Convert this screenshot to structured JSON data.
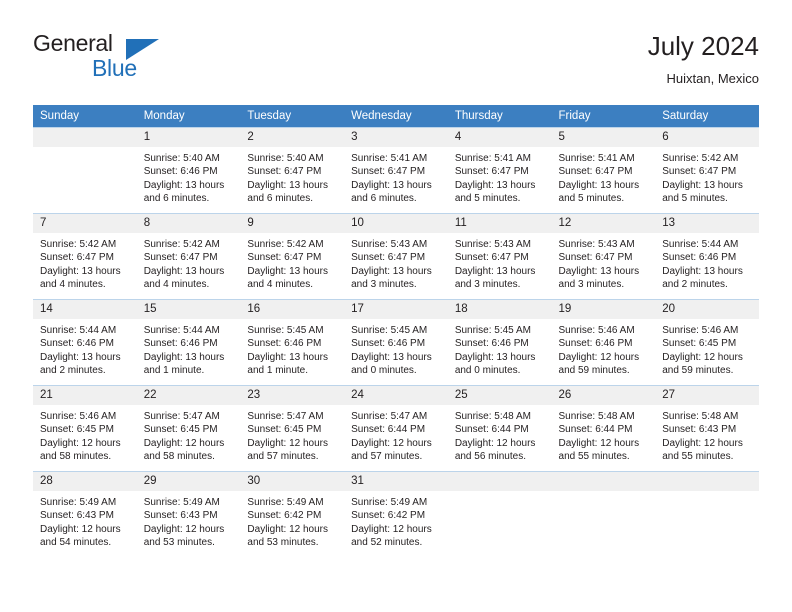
{
  "brand": {
    "name_part1": "General",
    "name_part2": "Blue",
    "accent_color": "#2170b8",
    "triangle_icon": "triangle-icon"
  },
  "header": {
    "title": "July 2024",
    "subtitle": "Huixtan, Mexico"
  },
  "calendar": {
    "header_bg": "#3c7fc1",
    "daynum_bg": "#f0f0f0",
    "grid_line_color": "#bcd4ea",
    "weekdays": [
      "Sunday",
      "Monday",
      "Tuesday",
      "Wednesday",
      "Thursday",
      "Friday",
      "Saturday"
    ],
    "weeks": [
      [
        {
          "day": "",
          "sunrise": "",
          "sunset": "",
          "daylight1": "",
          "daylight2": "",
          "empty": true
        },
        {
          "day": "1",
          "sunrise": "Sunrise: 5:40 AM",
          "sunset": "Sunset: 6:46 PM",
          "daylight1": "Daylight: 13 hours",
          "daylight2": "and 6 minutes.",
          "empty": false
        },
        {
          "day": "2",
          "sunrise": "Sunrise: 5:40 AM",
          "sunset": "Sunset: 6:47 PM",
          "daylight1": "Daylight: 13 hours",
          "daylight2": "and 6 minutes.",
          "empty": false
        },
        {
          "day": "3",
          "sunrise": "Sunrise: 5:41 AM",
          "sunset": "Sunset: 6:47 PM",
          "daylight1": "Daylight: 13 hours",
          "daylight2": "and 6 minutes.",
          "empty": false
        },
        {
          "day": "4",
          "sunrise": "Sunrise: 5:41 AM",
          "sunset": "Sunset: 6:47 PM",
          "daylight1": "Daylight: 13 hours",
          "daylight2": "and 5 minutes.",
          "empty": false
        },
        {
          "day": "5",
          "sunrise": "Sunrise: 5:41 AM",
          "sunset": "Sunset: 6:47 PM",
          "daylight1": "Daylight: 13 hours",
          "daylight2": "and 5 minutes.",
          "empty": false
        },
        {
          "day": "6",
          "sunrise": "Sunrise: 5:42 AM",
          "sunset": "Sunset: 6:47 PM",
          "daylight1": "Daylight: 13 hours",
          "daylight2": "and 5 minutes.",
          "empty": false
        }
      ],
      [
        {
          "day": "7",
          "sunrise": "Sunrise: 5:42 AM",
          "sunset": "Sunset: 6:47 PM",
          "daylight1": "Daylight: 13 hours",
          "daylight2": "and 4 minutes.",
          "empty": false
        },
        {
          "day": "8",
          "sunrise": "Sunrise: 5:42 AM",
          "sunset": "Sunset: 6:47 PM",
          "daylight1": "Daylight: 13 hours",
          "daylight2": "and 4 minutes.",
          "empty": false
        },
        {
          "day": "9",
          "sunrise": "Sunrise: 5:42 AM",
          "sunset": "Sunset: 6:47 PM",
          "daylight1": "Daylight: 13 hours",
          "daylight2": "and 4 minutes.",
          "empty": false
        },
        {
          "day": "10",
          "sunrise": "Sunrise: 5:43 AM",
          "sunset": "Sunset: 6:47 PM",
          "daylight1": "Daylight: 13 hours",
          "daylight2": "and 3 minutes.",
          "empty": false
        },
        {
          "day": "11",
          "sunrise": "Sunrise: 5:43 AM",
          "sunset": "Sunset: 6:47 PM",
          "daylight1": "Daylight: 13 hours",
          "daylight2": "and 3 minutes.",
          "empty": false
        },
        {
          "day": "12",
          "sunrise": "Sunrise: 5:43 AM",
          "sunset": "Sunset: 6:47 PM",
          "daylight1": "Daylight: 13 hours",
          "daylight2": "and 3 minutes.",
          "empty": false
        },
        {
          "day": "13",
          "sunrise": "Sunrise: 5:44 AM",
          "sunset": "Sunset: 6:46 PM",
          "daylight1": "Daylight: 13 hours",
          "daylight2": "and 2 minutes.",
          "empty": false
        }
      ],
      [
        {
          "day": "14",
          "sunrise": "Sunrise: 5:44 AM",
          "sunset": "Sunset: 6:46 PM",
          "daylight1": "Daylight: 13 hours",
          "daylight2": "and 2 minutes.",
          "empty": false
        },
        {
          "day": "15",
          "sunrise": "Sunrise: 5:44 AM",
          "sunset": "Sunset: 6:46 PM",
          "daylight1": "Daylight: 13 hours",
          "daylight2": "and 1 minute.",
          "empty": false
        },
        {
          "day": "16",
          "sunrise": "Sunrise: 5:45 AM",
          "sunset": "Sunset: 6:46 PM",
          "daylight1": "Daylight: 13 hours",
          "daylight2": "and 1 minute.",
          "empty": false
        },
        {
          "day": "17",
          "sunrise": "Sunrise: 5:45 AM",
          "sunset": "Sunset: 6:46 PM",
          "daylight1": "Daylight: 13 hours",
          "daylight2": "and 0 minutes.",
          "empty": false
        },
        {
          "day": "18",
          "sunrise": "Sunrise: 5:45 AM",
          "sunset": "Sunset: 6:46 PM",
          "daylight1": "Daylight: 13 hours",
          "daylight2": "and 0 minutes.",
          "empty": false
        },
        {
          "day": "19",
          "sunrise": "Sunrise: 5:46 AM",
          "sunset": "Sunset: 6:46 PM",
          "daylight1": "Daylight: 12 hours",
          "daylight2": "and 59 minutes.",
          "empty": false
        },
        {
          "day": "20",
          "sunrise": "Sunrise: 5:46 AM",
          "sunset": "Sunset: 6:45 PM",
          "daylight1": "Daylight: 12 hours",
          "daylight2": "and 59 minutes.",
          "empty": false
        }
      ],
      [
        {
          "day": "21",
          "sunrise": "Sunrise: 5:46 AM",
          "sunset": "Sunset: 6:45 PM",
          "daylight1": "Daylight: 12 hours",
          "daylight2": "and 58 minutes.",
          "empty": false
        },
        {
          "day": "22",
          "sunrise": "Sunrise: 5:47 AM",
          "sunset": "Sunset: 6:45 PM",
          "daylight1": "Daylight: 12 hours",
          "daylight2": "and 58 minutes.",
          "empty": false
        },
        {
          "day": "23",
          "sunrise": "Sunrise: 5:47 AM",
          "sunset": "Sunset: 6:45 PM",
          "daylight1": "Daylight: 12 hours",
          "daylight2": "and 57 minutes.",
          "empty": false
        },
        {
          "day": "24",
          "sunrise": "Sunrise: 5:47 AM",
          "sunset": "Sunset: 6:44 PM",
          "daylight1": "Daylight: 12 hours",
          "daylight2": "and 57 minutes.",
          "empty": false
        },
        {
          "day": "25",
          "sunrise": "Sunrise: 5:48 AM",
          "sunset": "Sunset: 6:44 PM",
          "daylight1": "Daylight: 12 hours",
          "daylight2": "and 56 minutes.",
          "empty": false
        },
        {
          "day": "26",
          "sunrise": "Sunrise: 5:48 AM",
          "sunset": "Sunset: 6:44 PM",
          "daylight1": "Daylight: 12 hours",
          "daylight2": "and 55 minutes.",
          "empty": false
        },
        {
          "day": "27",
          "sunrise": "Sunrise: 5:48 AM",
          "sunset": "Sunset: 6:43 PM",
          "daylight1": "Daylight: 12 hours",
          "daylight2": "and 55 minutes.",
          "empty": false
        }
      ],
      [
        {
          "day": "28",
          "sunrise": "Sunrise: 5:49 AM",
          "sunset": "Sunset: 6:43 PM",
          "daylight1": "Daylight: 12 hours",
          "daylight2": "and 54 minutes.",
          "empty": false
        },
        {
          "day": "29",
          "sunrise": "Sunrise: 5:49 AM",
          "sunset": "Sunset: 6:43 PM",
          "daylight1": "Daylight: 12 hours",
          "daylight2": "and 53 minutes.",
          "empty": false
        },
        {
          "day": "30",
          "sunrise": "Sunrise: 5:49 AM",
          "sunset": "Sunset: 6:42 PM",
          "daylight1": "Daylight: 12 hours",
          "daylight2": "and 53 minutes.",
          "empty": false
        },
        {
          "day": "31",
          "sunrise": "Sunrise: 5:49 AM",
          "sunset": "Sunset: 6:42 PM",
          "daylight1": "Daylight: 12 hours",
          "daylight2": "and 52 minutes.",
          "empty": false
        },
        {
          "day": "",
          "sunrise": "",
          "sunset": "",
          "daylight1": "",
          "daylight2": "",
          "empty": true
        },
        {
          "day": "",
          "sunrise": "",
          "sunset": "",
          "daylight1": "",
          "daylight2": "",
          "empty": true
        },
        {
          "day": "",
          "sunrise": "",
          "sunset": "",
          "daylight1": "",
          "daylight2": "",
          "empty": true
        }
      ]
    ]
  }
}
